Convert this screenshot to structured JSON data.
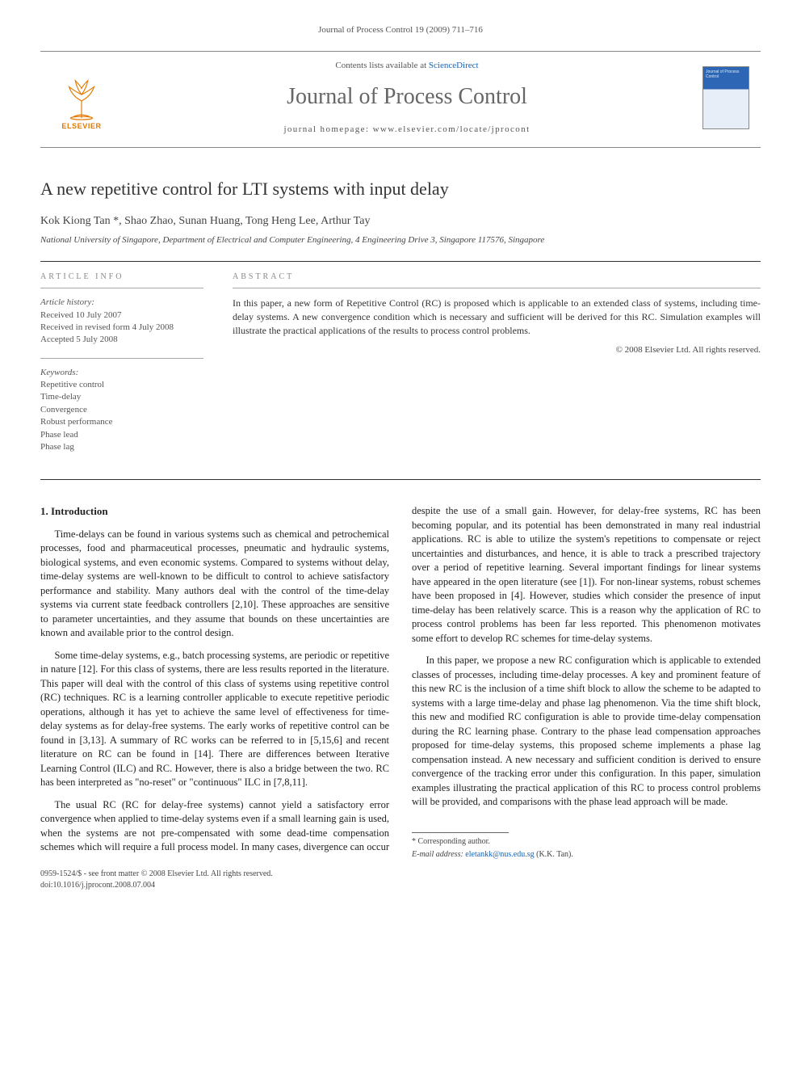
{
  "running_header": "Journal of Process Control 19 (2009) 711–716",
  "masthead": {
    "contents_prefix": "Contents lists available at ",
    "contents_link": "ScienceDirect",
    "journal_name": "Journal of Process Control",
    "homepage_prefix": "journal homepage: ",
    "homepage_url": "www.elsevier.com/locate/jprocont",
    "publisher_label": "ELSEVIER",
    "cover_text": "Journal of Process Control"
  },
  "paper": {
    "title": "A new repetitive control for LTI systems with input delay",
    "authors": "Kok Kiong Tan *, Shao Zhao, Sunan Huang, Tong Heng Lee, Arthur Tay",
    "affiliation": "National University of Singapore, Department of Electrical and Computer Engineering, 4 Engineering Drive 3, Singapore 117576, Singapore"
  },
  "article_info": {
    "heading": "article info",
    "history_label": "Article history:",
    "history": [
      "Received 10 July 2007",
      "Received in revised form 4 July 2008",
      "Accepted 5 July 2008"
    ],
    "keywords_label": "Keywords:",
    "keywords": [
      "Repetitive control",
      "Time-delay",
      "Convergence",
      "Robust performance",
      "Phase lead",
      "Phase lag"
    ]
  },
  "abstract": {
    "heading": "abstract",
    "text": "In this paper, a new form of Repetitive Control (RC) is proposed which is applicable to an extended class of systems, including time-delay systems. A new convergence condition which is necessary and sufficient will be derived for this RC. Simulation examples will illustrate the practical applications of the results to process control problems.",
    "copyright": "© 2008 Elsevier Ltd. All rights reserved."
  },
  "section1": {
    "heading": "1. Introduction",
    "p1": "Time-delays can be found in various systems such as chemical and petrochemical processes, food and pharmaceutical processes, pneumatic and hydraulic systems, biological systems, and even economic systems. Compared to systems without delay, time-delay systems are well-known to be difficult to control to achieve satisfactory performance and stability. Many authors deal with the control of the time-delay systems via current state feedback controllers [2,10]. These approaches are sensitive to parameter uncertainties, and they assume that bounds on these uncertainties are known and available prior to the control design.",
    "p2": "Some time-delay systems, e.g., batch processing systems, are periodic or repetitive in nature [12]. For this class of systems, there are less results reported in the literature. This paper will deal with the control of this class of systems using repetitive control (RC) techniques. RC is a learning controller applicable to execute repetitive periodic operations, although it has yet to achieve the same level of effectiveness for time-delay systems as for delay-free systems. The early works of repetitive control can be found in [3,13]. A summary of RC works can be referred to in [5,15,6] and recent literature on RC can be found in [14]. There are differences between Iterative Learning Control (ILC) and RC. However, there is also a bridge between the two. RC has been interpreted as \"no-reset\" or \"continuous\" ILC in [7,8,11].",
    "p3": "The usual RC (RC for delay-free systems) cannot yield a satisfactory error convergence when applied to time-delay systems even if a small learning gain is used, when the systems are not pre-compensated with some dead-time compensation schemes which will require a full process model. In many cases, divergence can occur despite the use of a small gain. However, for delay-free systems, RC has been becoming popular, and its potential has been demonstrated in many real industrial applications. RC is able to utilize the system's repetitions to compensate or reject uncertainties and disturbances, and hence, it is able to track a prescribed trajectory over a period of repetitive learning. Several important findings for linear systems have appeared in the open literature (see [1]). For non-linear systems, robust schemes have been proposed in [4]. However, studies which consider the presence of input time-delay has been relatively scarce. This is a reason why the application of RC to process control problems has been far less reported. This phenomenon motivates some effort to develop RC schemes for time-delay systems.",
    "p4": "In this paper, we propose a new RC configuration which is applicable to extended classes of processes, including time-delay processes. A key and prominent feature of this new RC is the inclusion of a time shift block to allow the scheme to be adapted to systems with a large time-delay and phase lag phenomenon. Via the time shift block, this new and modified RC configuration is able to provide time-delay compensation during the RC learning phase. Contrary to the phase lead compensation approaches proposed for time-delay systems, this proposed scheme implements a phase lag compensation instead. A new necessary and sufficient condition is derived to ensure convergence of the tracking error under this configuration. In this paper, simulation examples illustrating the practical application of this RC to process control problems will be provided, and comparisons with the phase lead approach will be made."
  },
  "footer": {
    "corr_label": "* Corresponding author.",
    "email_label": "E-mail address:",
    "email": "eletankk@nus.edu.sg",
    "email_person": "(K.K. Tan).",
    "front_matter": "0959-1524/$ - see front matter © 2008 Elsevier Ltd. All rights reserved.",
    "doi": "doi:10.1016/j.jprocont.2008.07.004"
  }
}
